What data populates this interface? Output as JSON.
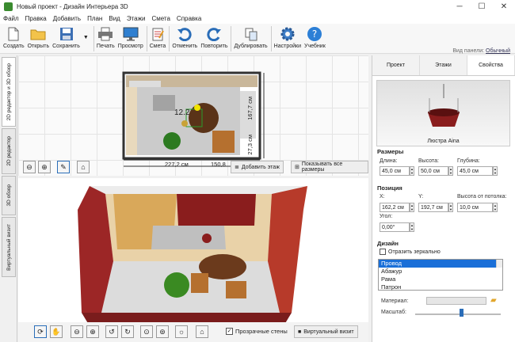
{
  "window": {
    "title": "Новый проект - Дизайн Интерьера 3D",
    "min": "─",
    "max": "☐",
    "close": "✕"
  },
  "menu": [
    "Файл",
    "Правка",
    "Добавить",
    "План",
    "Вид",
    "Этажи",
    "Смета",
    "Справка"
  ],
  "toolbar": {
    "create": "Создать",
    "open": "Открыть",
    "save": "Сохранить",
    "print": "Печать",
    "preview": "Просмотр",
    "estimate": "Смета",
    "undo": "Отменить",
    "redo": "Повторить",
    "duplicate": "Дублировать",
    "settings": "Настройки",
    "tutorial": "Учебник",
    "view_panel_label": "Вид панели:",
    "view_panel_value": "Обычный"
  },
  "left_tabs": {
    "editor": "2D редактор и 3D обзор",
    "editor2d": "2D редактор",
    "view3d": "3D обзор",
    "virtual": "Виртуальный визит"
  },
  "plan": {
    "dim_top": "227,2 см",
    "dim_bottom": "150,8",
    "dim_right1": "167,7 см",
    "dim_right2": "27,3 см",
    "label": "12.2",
    "add_floor": "Добавить этаж",
    "show_dims": "Показывать все размеры"
  },
  "bottom": {
    "transparent_walls": "Прозрачные стены",
    "virtual_visit": "Виртуальный визит"
  },
  "right": {
    "tabs": [
      "Проект",
      "Этажи",
      "Свойства"
    ],
    "preview_caption": "Люстра Aina",
    "size_title": "Размеры",
    "length_lbl": "Длина:",
    "height_lbl": "Высота:",
    "depth_lbl": "Глубина:",
    "length": "45,0 см",
    "height": "50,0 см",
    "depth": "45,0 см",
    "pos_title": "Позиция",
    "x_lbl": "X:",
    "y_lbl": "Y:",
    "ceil_lbl": "Высота от потолка:",
    "x": "162,2 см",
    "y": "192,7 см",
    "ceil": "10,0 см",
    "angle_lbl": "Угол:",
    "angle": "0,00°",
    "design_title": "Дизайн",
    "mirror": "Отразить зеркально",
    "parts": [
      "Провод",
      "Абажур",
      "Рама",
      "Патрон"
    ],
    "material_lbl": "Материал:",
    "scale_lbl": "Масштаб:"
  },
  "colors": {
    "accent": "#1a6fd8"
  }
}
